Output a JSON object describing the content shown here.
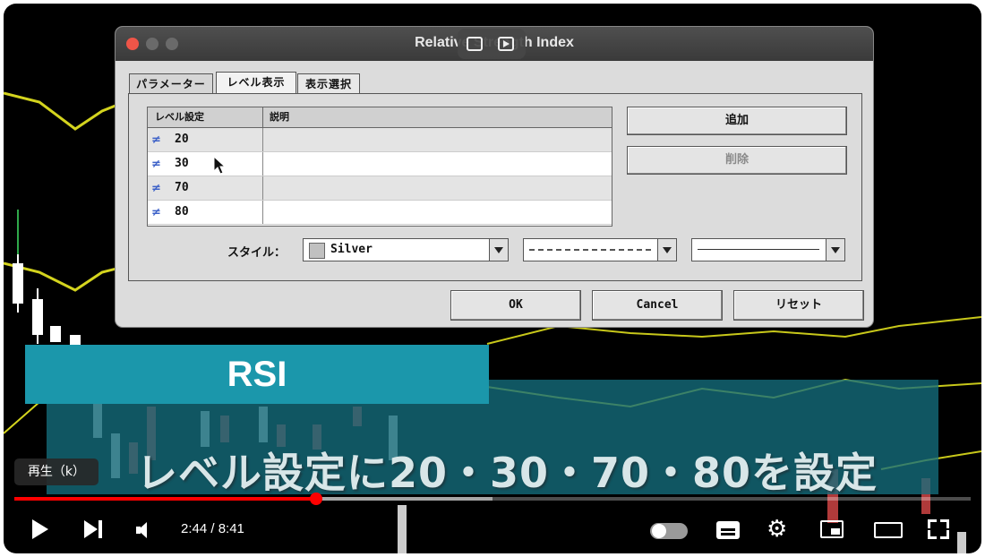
{
  "colors": {
    "rsi_banner": "#1b97ab",
    "caption_box": "#146e7d",
    "progress_played": "#ff0000",
    "chart_line": "#d4d41e",
    "candle_red": "#b03a3a",
    "level_icon": "#3e62c8"
  },
  "dialog": {
    "title": "Relative Strength Index",
    "tabs": [
      "パラメーター",
      "レベル表示",
      "表示選択"
    ],
    "active_tab": "レベル表示",
    "grid": {
      "headers": [
        "レベル設定",
        "説明"
      ],
      "rows": [
        {
          "icon": "level-line-icon",
          "glyph": "≠",
          "value": "20",
          "description": ""
        },
        {
          "icon": "level-line-icon",
          "glyph": "≠",
          "value": "30",
          "description": ""
        },
        {
          "icon": "level-line-icon",
          "glyph": "≠",
          "value": "70",
          "description": ""
        },
        {
          "icon": "level-line-icon",
          "glyph": "≠",
          "value": "80",
          "description": ""
        }
      ]
    },
    "add_button": "追加",
    "delete_button": "削除",
    "style_label": "スタイル：",
    "color_combo": {
      "swatch": "#c0c0c0",
      "value": "Silver"
    },
    "ok_button": "OK",
    "cancel_button": "Cancel",
    "reset_button": "リセット"
  },
  "overlay": {
    "banner": "RSI",
    "caption": "レベル設定に20・30・70・80を設定"
  },
  "player": {
    "tooltip": "再生（k）",
    "time": "2:44 / 8:41",
    "progress_played": 0.316,
    "progress_buffered": 0.5
  }
}
